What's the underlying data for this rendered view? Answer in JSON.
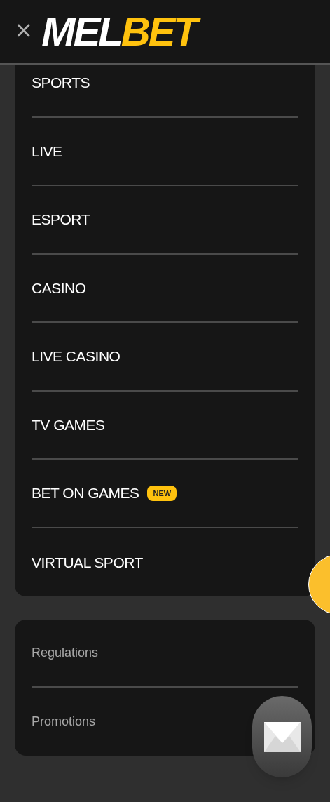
{
  "header": {
    "close": "×",
    "logo": [
      {
        "text": "MEL",
        "color": "#ffffff"
      },
      {
        "text": "BET",
        "color": "#ffc20e"
      }
    ]
  },
  "main_menu": [
    {
      "label": "SPORTS"
    },
    {
      "label": "LIVE"
    },
    {
      "label": "ESPORT"
    },
    {
      "label": "CASINO"
    },
    {
      "label": "LIVE CASINO"
    },
    {
      "label": "TV GAMES"
    },
    {
      "label": "BET ON GAMES",
      "badge": "NEW"
    },
    {
      "label": "VIRTUAL SPORT"
    }
  ],
  "info_menu": [
    {
      "label": "Regulations"
    },
    {
      "label": "Promotions"
    }
  ]
}
